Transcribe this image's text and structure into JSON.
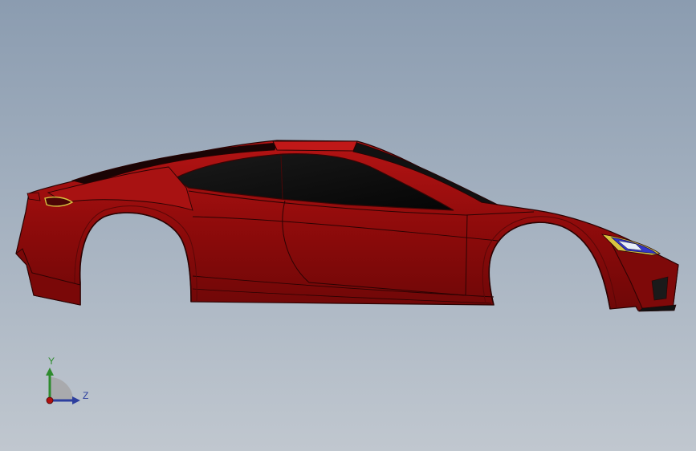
{
  "viewport": {
    "background_top": "#8b9cb0",
    "background_bottom": "#c0c7cf"
  },
  "model": {
    "body_color": "#8f0b0b",
    "glass_color": "#0a0a0a",
    "edge_color": "#2a0303",
    "highlight_color": "#c01818"
  },
  "triad": {
    "y_label": "Y",
    "z_label": "Z",
    "y_color": "#2e8b2e",
    "z_color": "#2d3f9e",
    "x_color": "#b01010"
  }
}
